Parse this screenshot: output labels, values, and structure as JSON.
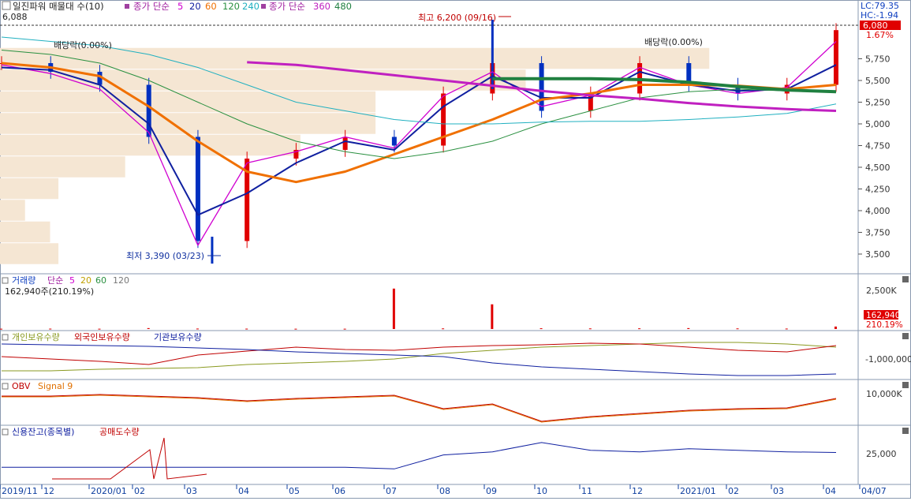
{
  "window": {
    "title": "일진파워 매물대 수(10)",
    "legend_ma": {
      "label": "종가 단순",
      "periods": [
        "5",
        "20",
        "60",
        "120",
        "240"
      ]
    },
    "legend_ma_long": {
      "label": "종가 단순",
      "periods": [
        "360",
        "480"
      ]
    },
    "top_left_price": "6,088"
  },
  "colors": {
    "up": "#e00000",
    "down": "#0030c0",
    "ma5": "#d000d0",
    "ma20": "#1020a0",
    "ma60": "#f07000",
    "ma120": "#2a9040",
    "ma240": "#20b0c0",
    "ma360": "#c020c0",
    "ma480": "#208040",
    "volume_profile": "#f5e6d3",
    "axis": "#1040a0",
    "last_price_bg": "#e00000"
  },
  "price_panel": {
    "right_labels": {
      "lc": "LC:79.35",
      "hc": "HC:-1.94",
      "last_price": "6,080",
      "change_pct": "1.67%"
    },
    "annotations": {
      "high": "최고 6,200 (09/16)",
      "low": "최저 3,390 (03/23)",
      "dividend_1": "배당락(0.00%)",
      "dividend_2": "배당락(0.00%)"
    }
  },
  "volume_panel": {
    "title": "거래량",
    "legend": {
      "label": "단순",
      "periods": [
        "5",
        "20",
        "60",
        "120"
      ]
    },
    "current": "162,940주(210.19%)",
    "last_value": "162,940",
    "last_pct": "210.19%",
    "axis_label": "2,500K"
  },
  "holding_panel": {
    "labels": [
      "개인보유수량",
      "외국인보유수량",
      "기관보유수량"
    ],
    "axis_label": "-1,000,000"
  },
  "obv_panel": {
    "labels": [
      "OBV",
      "Signal 9"
    ],
    "axis_label": "10,000K"
  },
  "credit_panel": {
    "labels": [
      "신용잔고(종목별)",
      "공매도수량"
    ],
    "axis_label": "25,000"
  },
  "x_axis": {
    "labels": [
      "2019/11",
      "12",
      "2020/01",
      "02",
      "03",
      "04",
      "05",
      "06",
      "07",
      "08",
      "09",
      "10",
      "11",
      "12",
      "2021/01",
      "02",
      "03",
      "04",
      "04/07"
    ]
  },
  "chart_data": {
    "type": "line",
    "title": "일진파워",
    "x": [
      "2019/11",
      "2019/12",
      "2020/01",
      "2020/02",
      "2020/03",
      "2020/04",
      "2020/05",
      "2020/06",
      "2020/07",
      "2020/08",
      "2020/09",
      "2020/10",
      "2020/11",
      "2020/12",
      "2021/01",
      "2021/02",
      "2021/03",
      "2021/04"
    ],
    "ylim": [
      3300,
      6300
    ],
    "y_ticks": [
      3500,
      3750,
      4000,
      4250,
      4500,
      4750,
      5000,
      5250,
      5500,
      5750
    ],
    "series": [
      {
        "name": "종가",
        "values": [
          5700,
          5600,
          5450,
          4850,
          3650,
          4600,
          4700,
          4850,
          4750,
          5350,
          5700,
          5150,
          5350,
          5700,
          5450,
          5350,
          5450,
          6080
        ]
      },
      {
        "name": "5",
        "values": [
          5680,
          5580,
          5400,
          4900,
          3600,
          4550,
          4680,
          4850,
          4720,
          5320,
          5600,
          5200,
          5330,
          5650,
          5450,
          5350,
          5420,
          5950
        ]
      },
      {
        "name": "20",
        "values": [
          5650,
          5620,
          5450,
          5000,
          3950,
          4200,
          4550,
          4800,
          4700,
          5200,
          5550,
          5300,
          5300,
          5600,
          5450,
          5380,
          5400,
          5680
        ]
      },
      {
        "name": "60",
        "values": [
          5700,
          5650,
          5550,
          5200,
          4800,
          4450,
          4330,
          4450,
          4650,
          4850,
          5050,
          5280,
          5350,
          5450,
          5450,
          5440,
          5400,
          5450
        ]
      },
      {
        "name": "120",
        "values": [
          5850,
          5800,
          5700,
          5500,
          5250,
          5000,
          4800,
          4680,
          4600,
          4680,
          4800,
          5000,
          5150,
          5300,
          5370,
          5400,
          5380,
          5380
        ]
      },
      {
        "name": "240",
        "values": [
          6000,
          5950,
          5900,
          5800,
          5650,
          5450,
          5250,
          5150,
          5050,
          5000,
          5000,
          5020,
          5030,
          5030,
          5050,
          5080,
          5120,
          5230
        ]
      },
      {
        "name": "360",
        "values": [
          null,
          null,
          null,
          null,
          null,
          5710,
          5680,
          5620,
          5560,
          5500,
          5440,
          5380,
          5330,
          5290,
          5240,
          5200,
          5170,
          5150
        ]
      },
      {
        "name": "480",
        "values": [
          null,
          null,
          null,
          null,
          null,
          null,
          null,
          null,
          null,
          null,
          5520,
          5520,
          5520,
          5510,
          5480,
          5430,
          5390,
          5370
        ]
      }
    ],
    "volume_profile_levels": [
      3500,
      3750,
      4000,
      4250,
      4500,
      4750,
      5000,
      5250,
      5500,
      5750
    ],
    "volume_profile_share": [
      0.07,
      0.06,
      0.03,
      0.07,
      0.15,
      0.36,
      0.45,
      0.45,
      0.63,
      0.85
    ],
    "volume_k": [
      20,
      25,
      20,
      60,
      30,
      25,
      20,
      20,
      2700,
      40,
      1650,
      50,
      40,
      45,
      60,
      40,
      30,
      163
    ],
    "credit": [
      20000,
      20000,
      20000,
      20000,
      20000,
      20000,
      20000,
      20000,
      19500,
      24000,
      25000,
      28000,
      25500,
      25000,
      26000,
      25500,
      25000,
      24800
    ],
    "high": {
      "date": "09/16",
      "value": 6200
    },
    "low": {
      "date": "03/23",
      "value": 3390
    }
  }
}
